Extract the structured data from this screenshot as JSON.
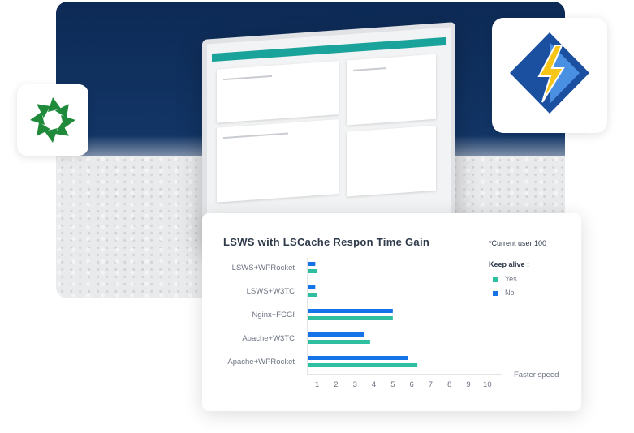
{
  "colors": {
    "yes": "#2ebfa0",
    "no": "#1473e6",
    "hero_bg": "#123566",
    "logo_left": "#1f8a3a"
  },
  "logos": {
    "left": "green-pinwheel-logo",
    "right": "litespeed-logo"
  },
  "chart_data": {
    "type": "bar",
    "orientation": "horizontal",
    "title": "LSWS with LSCache Respon Time Gain",
    "note": "*Current user 100",
    "legend_title": "Keep alive :",
    "legend_placement": "right",
    "categories": [
      "LSWS+WPRocket",
      "LSWS+W3TC",
      "Nginx+FCGI",
      "Apache+W3TC",
      "Apache+WPRocket"
    ],
    "series": [
      {
        "name": "No",
        "values": [
          0.4,
          0.4,
          4.5,
          3.0,
          5.3
        ]
      },
      {
        "name": "Yes",
        "values": [
          0.5,
          0.5,
          4.5,
          3.3,
          5.8
        ]
      }
    ],
    "xticks": [
      "1",
      "2",
      "3",
      "4",
      "5",
      "6",
      "7",
      "8",
      "9",
      "10"
    ],
    "xlabel": "Faster speed",
    "xlim": [
      0.5,
      10.5
    ],
    "grid": false
  }
}
